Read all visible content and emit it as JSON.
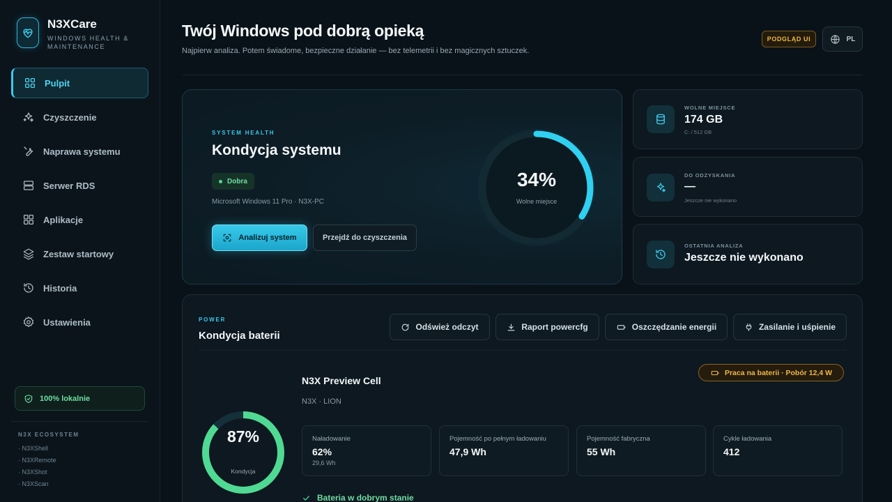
{
  "brand": {
    "name": "N3XCare",
    "subtitle": "WINDOWS HEALTH & MAINTENANCE"
  },
  "sidebar": {
    "items": [
      {
        "label": "Pulpit",
        "icon": "grid-icon",
        "active": true
      },
      {
        "label": "Czyszczenie",
        "icon": "sparkles-icon"
      },
      {
        "label": "Naprawa systemu",
        "icon": "wrench-icon"
      },
      {
        "label": "Serwer RDS",
        "icon": "server-icon"
      },
      {
        "label": "Aplikacje",
        "icon": "apps-icon"
      },
      {
        "label": "Zestaw startowy",
        "icon": "layers-icon"
      },
      {
        "label": "Historia",
        "icon": "history-icon"
      },
      {
        "label": "Ustawienia",
        "icon": "gear-icon"
      }
    ],
    "local_badge": "100% lokalnie",
    "ecosystem": {
      "title": "N3X ECOSYSTEM",
      "items": [
        "· N3XShell",
        "· N3XRemote",
        "· N3XShot",
        "· N3XScan"
      ]
    }
  },
  "header": {
    "title": "Twój Windows pod dobrą opieką",
    "subtitle": "Najpierw analiza. Potem świadome, bezpieczne działanie — bez telemetrii i bez magicznych sztuczek.",
    "preview_badge": "PODGLĄD UI",
    "lang": "PL"
  },
  "health": {
    "eyebrow": "SYSTEM HEALTH",
    "title": "Kondycja systemu",
    "status": "Dobra",
    "os": "Microsoft Windows 11 Pro · N3X-PC",
    "analyze_label": "Analizuj system",
    "clean_label": "Przejdź do czyszczenia",
    "gauge_value": "34%",
    "gauge_fraction": 0.34,
    "gauge_label": "Wolne miejsce"
  },
  "stats": {
    "free": {
      "label": "WOLNE MIEJSCE",
      "value": "174 GB",
      "sub": "C: / 512 GB"
    },
    "recoverable": {
      "label": "DO ODZYSKANIA",
      "value": "—",
      "sub": "Jeszcze nie wykonano"
    },
    "last": {
      "label": "OSTATNIA ANALIZA",
      "value": "Jeszcze nie wykonano"
    }
  },
  "battery": {
    "eyebrow": "POWER",
    "title": "Kondycja baterii",
    "refresh_label": "Odśwież odczyt",
    "report_label": "Raport powercfg",
    "saver_label": "Oszczędzanie energii",
    "power_label": "Zasilanie i uśpienie",
    "cell_name": "N3X Preview Cell",
    "cell_sub": "N3X · LION",
    "status": "Praca na baterii · Pobór 12,4 W",
    "health_value": "87%",
    "health_fraction": 0.87,
    "health_label": "Kondycja",
    "metrics": [
      {
        "label": "Naładowanie",
        "value": "62%",
        "sub": "29,6 Wh"
      },
      {
        "label": "Pojemność po pełnym ładowaniu",
        "value": "47,9 Wh",
        "sub": ""
      },
      {
        "label": "Pojemność fabryczna",
        "value": "55 Wh",
        "sub": ""
      },
      {
        "label": "Cykle ładowania",
        "value": "412",
        "sub": ""
      }
    ],
    "ok_text": "Bateria w dobrym stanie"
  },
  "colors": {
    "accent": "#3ccbeb",
    "good": "#4fd992",
    "warn": "#f1b548",
    "bg": "#0a1219"
  }
}
